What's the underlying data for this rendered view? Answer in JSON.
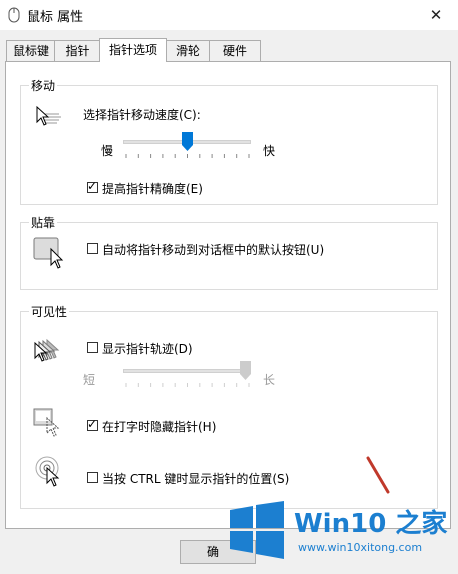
{
  "window": {
    "title": "鼠标 属性",
    "close_glyph": "✕"
  },
  "tabs": [
    {
      "label": "鼠标键"
    },
    {
      "label": "指针"
    },
    {
      "label": "指针选项"
    },
    {
      "label": "滑轮"
    },
    {
      "label": "硬件"
    }
  ],
  "active_tab": "指针选项",
  "motion": {
    "title": "移动",
    "speed_label": "选择指针移动速度(C):",
    "slow_label": "慢",
    "fast_label": "快",
    "speed_value_fraction": 0.5,
    "precision_label": "提高指针精确度(E)",
    "precision_checked": true,
    "icon": "pointer-motion-icon"
  },
  "snap_to": {
    "title": "贴靠",
    "label": "自动将指针移动到对话框中的默认按钮(U)",
    "checked": false,
    "icon": "snap-to-button-icon"
  },
  "visibility": {
    "title": "可见性",
    "trails_label": "显示指针轨迹(D)",
    "trails_checked": false,
    "short_label": "短",
    "long_label": "长",
    "trails_value_fraction": 1.0,
    "hide_typing_label": "在打字时隐藏指针(H)",
    "hide_typing_checked": true,
    "ctrl_label": "当按 CTRL 键时显示指针的位置(S)",
    "ctrl_checked": false,
    "icons": [
      "pointer-trails-icon",
      "hide-pointer-icon",
      "ctrl-locate-icon"
    ]
  },
  "footer": {
    "ok_label": "确"
  },
  "watermark": {
    "title": "Win10 之家",
    "url": "www.win10xitong.com",
    "colors": {
      "brand": "#1c7fd0"
    }
  },
  "colors": {
    "accent": "#0078d7",
    "annotation_line": "#c0392b"
  }
}
